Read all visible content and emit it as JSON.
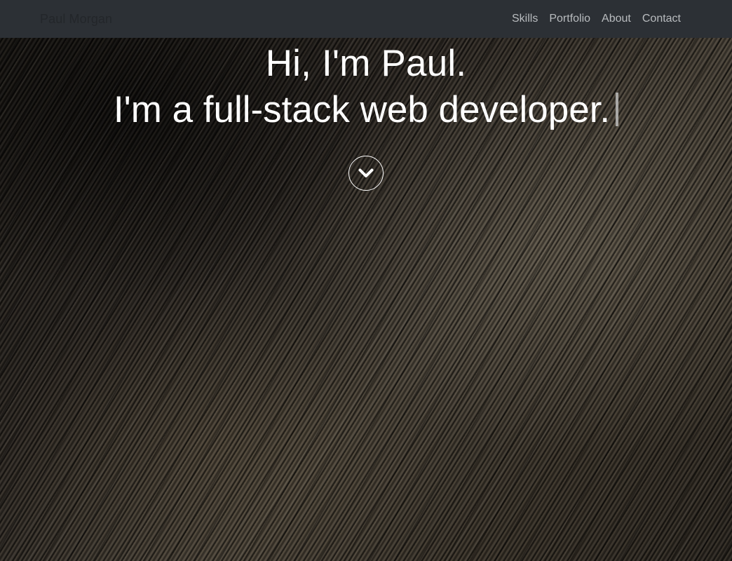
{
  "navbar": {
    "brand": "Paul Morgan",
    "links": [
      {
        "label": "Skills"
      },
      {
        "label": "Portfolio"
      },
      {
        "label": "About"
      },
      {
        "label": "Contact"
      }
    ]
  },
  "hero": {
    "greeting": "Hi, I'm Paul.",
    "tagline": "I'm a full-stack web developer.",
    "scroll_icon": "chevron-down-icon"
  },
  "colors": {
    "navbar_bg": "#2c3035",
    "nav_link": "#b9bcbf",
    "hero_text": "#ffffff"
  }
}
